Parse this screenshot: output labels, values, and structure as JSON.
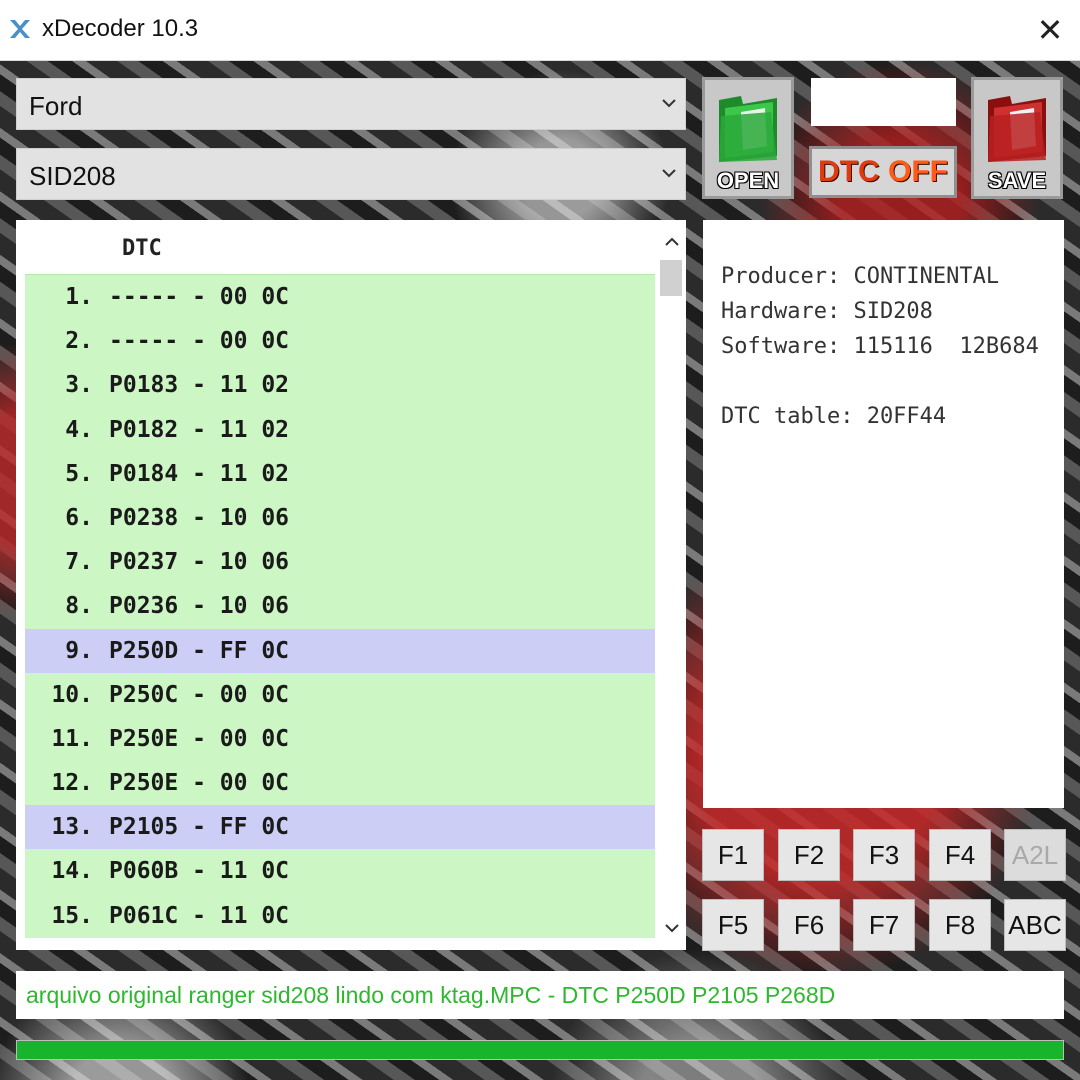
{
  "window": {
    "title": "xDecoder 10.3"
  },
  "selectors": {
    "make": "Ford",
    "ecu": "SID208"
  },
  "buttons": {
    "open": "OPEN",
    "save": "SAVE",
    "dtc_off_1": "DTC",
    "dtc_off_2": "OFF"
  },
  "list": {
    "header": "DTC",
    "rows": [
      {
        "num": "1.",
        "code": "----- - 00 0C",
        "selected": false
      },
      {
        "num": "2.",
        "code": "----- - 00 0C",
        "selected": false
      },
      {
        "num": "3.",
        "code": "P0183 - 11 02",
        "selected": false
      },
      {
        "num": "4.",
        "code": "P0182 - 11 02",
        "selected": false
      },
      {
        "num": "5.",
        "code": "P0184 - 11 02",
        "selected": false
      },
      {
        "num": "6.",
        "code": "P0238 - 10 06",
        "selected": false
      },
      {
        "num": "7.",
        "code": "P0237 - 10 06",
        "selected": false
      },
      {
        "num": "8.",
        "code": "P0236 - 10 06",
        "selected": false
      },
      {
        "num": "9.",
        "code": "P250D - FF 0C",
        "selected": true
      },
      {
        "num": "10.",
        "code": "P250C - 00 0C",
        "selected": false
      },
      {
        "num": "11.",
        "code": "P250E - 00 0C",
        "selected": false
      },
      {
        "num": "12.",
        "code": "P250E - 00 0C",
        "selected": false
      },
      {
        "num": "13.",
        "code": "P2105 - FF 0C",
        "selected": true
      },
      {
        "num": "14.",
        "code": "P060B - 11 0C",
        "selected": false
      },
      {
        "num": "15.",
        "code": "P061C - 11 0C",
        "selected": false
      }
    ]
  },
  "info": {
    "producer": "Producer: CONTINENTAL",
    "hardware": "Hardware: SID208",
    "software": "Software: 115116  12B684",
    "dtc_table": "DTC table: 20FF44"
  },
  "fkeys": {
    "f1": "F1",
    "f2": "F2",
    "f3": "F3",
    "f4": "F4",
    "a2l": "A2L",
    "f5": "F5",
    "f6": "F6",
    "f7": "F7",
    "f8": "F8",
    "abc": "ABC"
  },
  "status": {
    "text": "arquivo original ranger sid208 lindo com ktag.MPC - DTC P250D P2105 P268D"
  },
  "progress": {
    "percent": 100
  },
  "colors": {
    "row_normal": "#ccf6c4",
    "row_selected": "#cccef6",
    "status_text": "#2db82d",
    "progress": "#17b42c"
  }
}
